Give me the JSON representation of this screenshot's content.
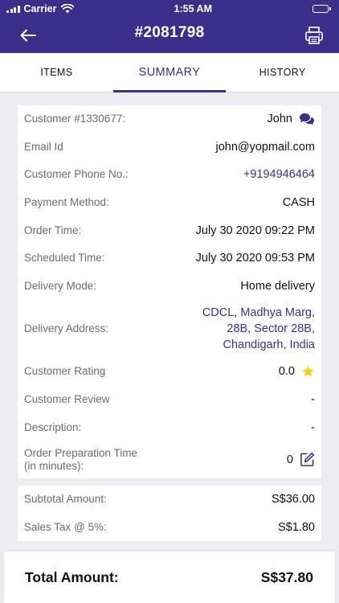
{
  "status_bar": {
    "carrier": "Carrier",
    "time": "1:55 AM",
    "battery_color": "#ff3b30"
  },
  "header": {
    "title": "#2081798",
    "back_icon": "arrow-left-icon",
    "print_icon": "printer-icon",
    "background": "#3c2f8a"
  },
  "tabs": [
    {
      "label": "ITEMS",
      "active": false
    },
    {
      "label": "SUMMARY",
      "active": true
    },
    {
      "label": "HISTORY",
      "active": false
    }
  ],
  "details": {
    "customer": {
      "label": "Customer #1330677:",
      "value": "John",
      "icon": "chat-icon"
    },
    "email": {
      "label": "Email Id",
      "value": "john@yopmail.com"
    },
    "phone": {
      "label": "Customer Phone No.:",
      "value": "+9194946464"
    },
    "payment": {
      "label": "Payment Method:",
      "value": "CASH"
    },
    "order_time": {
      "label": "Order Time:",
      "value": "July 30 2020 09:22 PM"
    },
    "scheduled_time": {
      "label": "Scheduled Time:",
      "value": "July 30 2020 09:53 PM"
    },
    "delivery_mode": {
      "label": "Delivery Mode:",
      "value": "Home delivery"
    },
    "delivery_address": {
      "label": "Delivery Address:",
      "lines": [
        "CDCL, Madhya Marg,",
        "28B, Sector 28B,",
        "Chandigarh, India"
      ]
    },
    "rating": {
      "label": "Customer Rating",
      "value": "0.0",
      "icon": "star-icon",
      "star_color": "#f5d21a"
    },
    "review": {
      "label": "Customer Review",
      "value": "-"
    },
    "description": {
      "label": "Description:",
      "value": "-"
    },
    "prep_time": {
      "label_line1": "Order Preparation Time",
      "label_line2": "(in minutes):",
      "value": "0",
      "icon": "edit-icon"
    }
  },
  "amounts": {
    "subtotal": {
      "label": "Subtotal Amount:",
      "value": "S$36.00"
    },
    "tax": {
      "label": "Sales Tax @ 5%:",
      "value": "S$1.80"
    }
  },
  "total": {
    "label": "Total Amount:",
    "value": "S$37.80"
  }
}
